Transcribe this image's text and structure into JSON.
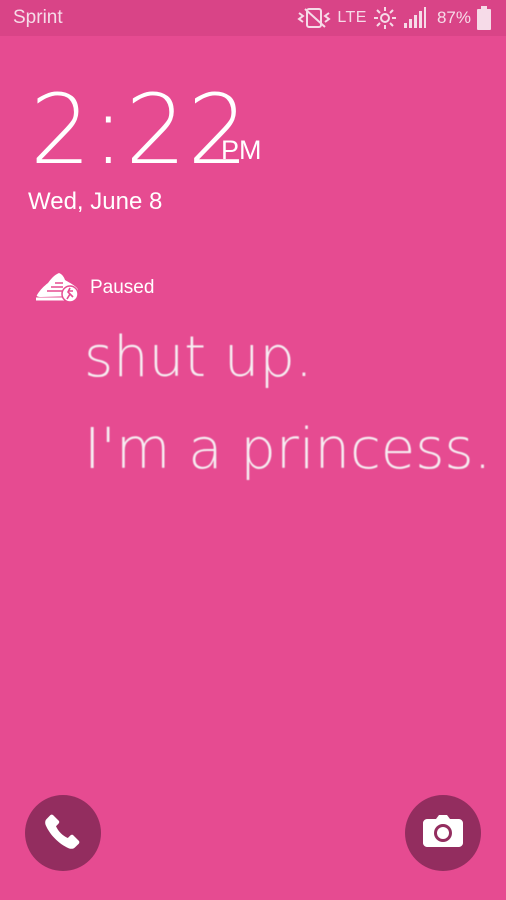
{
  "status_bar": {
    "carrier": "Sprint",
    "network": "LTE",
    "battery_percent": "87%",
    "icons": [
      "vibrate-icon",
      "network-activity-icon",
      "signal-icon",
      "battery-icon"
    ]
  },
  "clock": {
    "time": "2:22",
    "ampm": "PM",
    "date": "Wed, June 8"
  },
  "notification": {
    "icon": "running-shoe-icon",
    "text": "Paused"
  },
  "wallpaper": {
    "line1": "shut up.",
    "line2": "I'm a princess."
  },
  "shortcuts": {
    "left": "phone-icon",
    "right": "camera-icon"
  },
  "colors": {
    "background": "#e64b91",
    "status_bar": "#d94487",
    "shortcut_circle": "#932d5f",
    "foreground": "#ffffff"
  }
}
